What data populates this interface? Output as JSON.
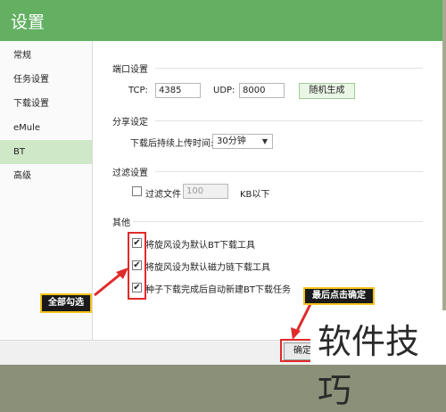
{
  "window": {
    "title": "设置"
  },
  "sidebar": {
    "items": [
      {
        "label": "常规",
        "active": false
      },
      {
        "label": "任务设置",
        "active": false
      },
      {
        "label": "下载设置",
        "active": false
      },
      {
        "label": "eMule",
        "active": false
      },
      {
        "label": "BT",
        "active": true
      },
      {
        "label": "高级",
        "active": false
      }
    ]
  },
  "port": {
    "section_title": "端口设置",
    "tcp_label": "TCP:",
    "tcp_value": "4385",
    "udp_label": "UDP:",
    "udp_value": "8000",
    "random_button": "随机生成"
  },
  "share": {
    "section_title": "分享设定",
    "duration_label": "下载后持续上传时间:",
    "duration_value": "30分钟"
  },
  "filter": {
    "section_title": "过滤设置",
    "checkbox_label": "过滤文件",
    "checked": false,
    "size_value": "100",
    "unit_label": "KB以下"
  },
  "other": {
    "section_title": "其他",
    "options": [
      {
        "label": "将旋风设为默认BT下载工具",
        "checked": true
      },
      {
        "label": "将旋风设为默认磁力链下载工具",
        "checked": true
      },
      {
        "label": "种子下载完成后自动新建BT下载任务",
        "checked": true
      }
    ]
  },
  "footer": {
    "ok_button": "确定"
  },
  "annotations": {
    "select_all": "全部勾选",
    "finally_click_ok": "最后点击确定"
  },
  "watermark": "软件技巧",
  "colors": {
    "titlebar": "#63b063",
    "active_item": "#cfe8c8",
    "annotation_red": "#e02a2a",
    "callout_border": "#f5c31c"
  }
}
